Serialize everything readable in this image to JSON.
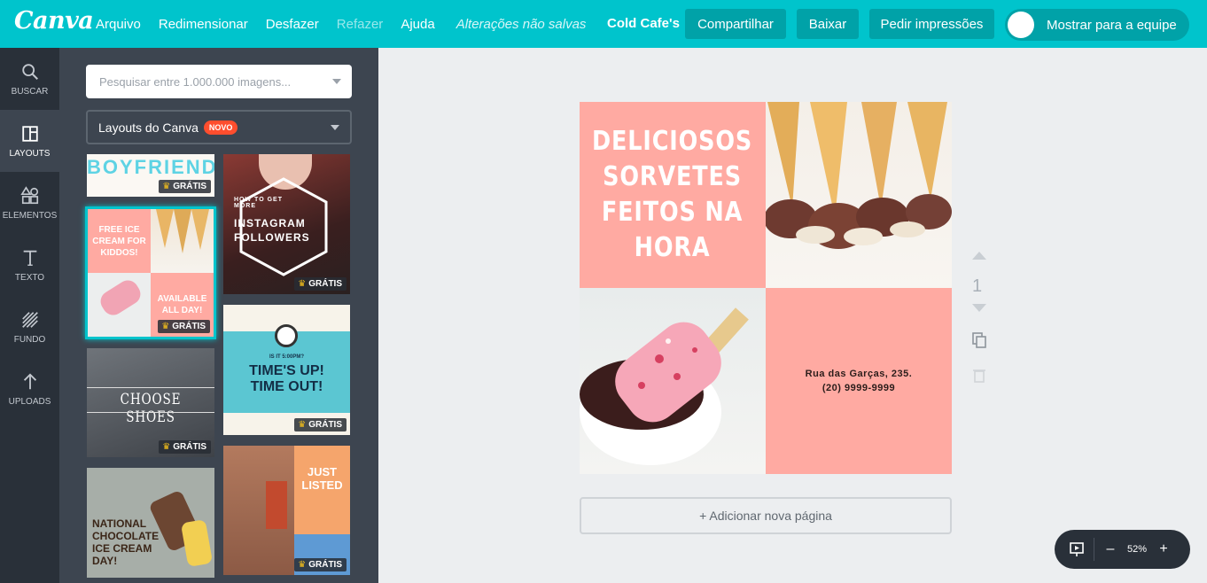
{
  "app": {
    "logo": "Canva"
  },
  "menu": {
    "items": [
      "Arquivo",
      "Redimensionar",
      "Desfazer",
      "Refazer",
      "Ajuda"
    ],
    "unsaved": "Alterações não salvas"
  },
  "header": {
    "design_name": "Cold Cafe's",
    "share_label": "Compartilhar",
    "download_label": "Baixar",
    "print_label": "Pedir impressões",
    "team_label": "Mostrar para a equipe"
  },
  "leftnav": [
    {
      "label": "BUSCAR",
      "icon": "search-icon"
    },
    {
      "label": "LAYOUTS",
      "icon": "layouts-icon"
    },
    {
      "label": "ELEMENTOS",
      "icon": "elements-icon"
    },
    {
      "label": "TEXTO",
      "icon": "text-icon"
    },
    {
      "label": "FUNDO",
      "icon": "background-icon"
    },
    {
      "label": "UPLOADS",
      "icon": "upload-icon"
    }
  ],
  "panel": {
    "search_placeholder": "Pesquisar entre 1.000.000 imagens...",
    "layouts_label": "Layouts do Canva",
    "badge": "NOVO",
    "free_label": "GRÁTIS",
    "thumbs": {
      "boyfriend": "BOYFRIEND",
      "icecream_top": "FREE ICE CREAM FOR KIDDOS!",
      "icecream_bottom": "AVAILABLE ALL DAY!",
      "shoes": "CHOOSE SHOES",
      "chocolate": "NATIONAL CHOCOLATE ICE CREAM DAY!",
      "instagram_small": "HOW TO GET MORE",
      "instagram": "INSTAGRAM FOLLOWERS",
      "times_small": "IS IT 5:00PM?",
      "times": "TIME'S UP! TIME OUT!",
      "listed": "JUST LISTED"
    }
  },
  "design": {
    "headline": [
      "DELICIOSOS",
      "SORVETES",
      "FEITOS NA",
      "HORA"
    ],
    "address": "Rua das Garças, 235.",
    "phone": "(20) 9999-9999",
    "colors": {
      "pink": "#ffaaa2",
      "brand": "#00c4cc"
    }
  },
  "canvas": {
    "page_number": "1",
    "add_page": "+ Adicionar nova página",
    "zoom": "52%"
  }
}
